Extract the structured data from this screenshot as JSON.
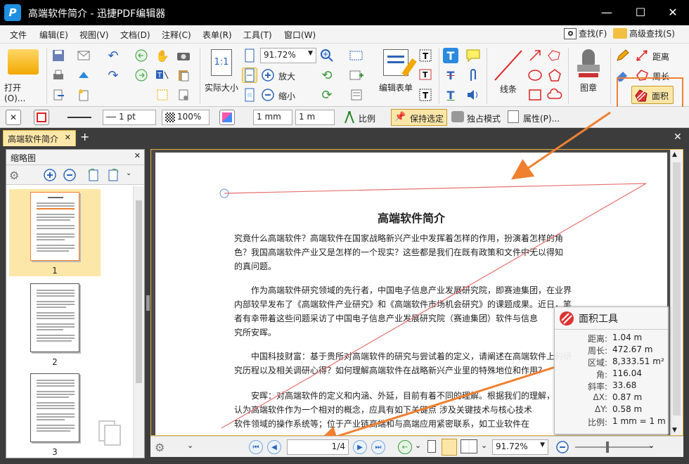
{
  "window": {
    "title": "高端软件简介 - 迅捷PDF编辑器",
    "logo": "P",
    "minimize": "—",
    "maximize": "☐",
    "close": "✕"
  },
  "menu": {
    "items": [
      "文件",
      "编辑(E)",
      "视图(V)",
      "文档(D)",
      "注释(C)",
      "表单(R)",
      "工具(T)",
      "窗口(W)"
    ],
    "find": "查找(F)",
    "advanced_find": "高级查找(S)"
  },
  "ribbon": {
    "open": "打开(O)...",
    "actual_size": "实际大小",
    "zoom_value": "91.72%",
    "zoom_in": "放大",
    "zoom_out": "缩小",
    "edit_form": "编辑表单",
    "line": "线条",
    "stamp": "图章",
    "distance": "距离",
    "perimeter": "周长",
    "area": "面积",
    "actual_size_icon_text": "1:1"
  },
  "propbar": {
    "line_width": "1 pt",
    "opacity": "100%",
    "unit1": "1 mm",
    "unit2": "1 m",
    "scale": "比例",
    "keep_selected": "保持选定",
    "exclusive_mode": "独占模式",
    "properties": "属性(P)..."
  },
  "tabs": {
    "active": "高端软件简介",
    "add": "+",
    "close": "✕"
  },
  "thumbnails": {
    "title": "缩略图",
    "pages": [
      "1",
      "2",
      "3"
    ]
  },
  "document": {
    "title": "高端软件简介",
    "paragraphs": [
      [
        "究竟什么高端软件？高端软件在国家战略新兴产业中发挥着怎样的作用，扮演着怎样的角",
        "色？我国高端软件产业又是怎样的一个现实？这些都是我们在既有政策和文件中无以得知",
        "的真问题。"
      ],
      [
        "　　作为高端软件研究领域的先行者，中国电子信息产业发展研究院，即赛迪集团，在业界",
        "内部较早发布了《高端软件产业研究》和《高端软件市场机会研究》的课题成果。近日，笔",
        "者有幸带着这些问题采访了中国电子信息产业发展研究院（赛迪集团）软件与信息",
        "究所安晖。"
      ],
      [
        "　　中国科技财富：基于贵所对高端软件的研究与尝试着的定义，请阐述在高端软件上的研",
        "究历程以及相关调研心得？如何理解高端软件在战略新兴产业里的特殊地位和作用？"
      ],
      [
        "　　安晖：对高端软件的定义和内涵、外延，目前有着不同的理解。根据我们的理解，",
        "认为高端软件作为一个相对的概念，应具有如下关键点 涉及关键技术与核心技术",
        "软件领域的操作系统等；位于产业链高端和与高端应用紧密联系，如工业软件在"
      ]
    ]
  },
  "area_tool": {
    "title": "面积工具",
    "rows": [
      {
        "k": "距离:",
        "v": "1.04 m"
      },
      {
        "k": "周长:",
        "v": "472.67 m"
      },
      {
        "k": "区域:",
        "v": "8,333.51 m²"
      },
      {
        "k": "角:",
        "v": "116.04"
      },
      {
        "k": "斜率:",
        "v": "33.68"
      },
      {
        "k": "ΔX:",
        "v": "0.87 m"
      },
      {
        "k": "ΔY:",
        "v": "0.58 m"
      },
      {
        "k": "比例:",
        "v": "1 mm = 1 m"
      }
    ]
  },
  "status": {
    "page_input": "1",
    "page_total": "/4",
    "zoom": "91.72%"
  },
  "colors": {
    "accent": "#f08030",
    "measure_line": "#e87070",
    "title_bar": "#000000",
    "tab_active": "#fde7a8"
  }
}
